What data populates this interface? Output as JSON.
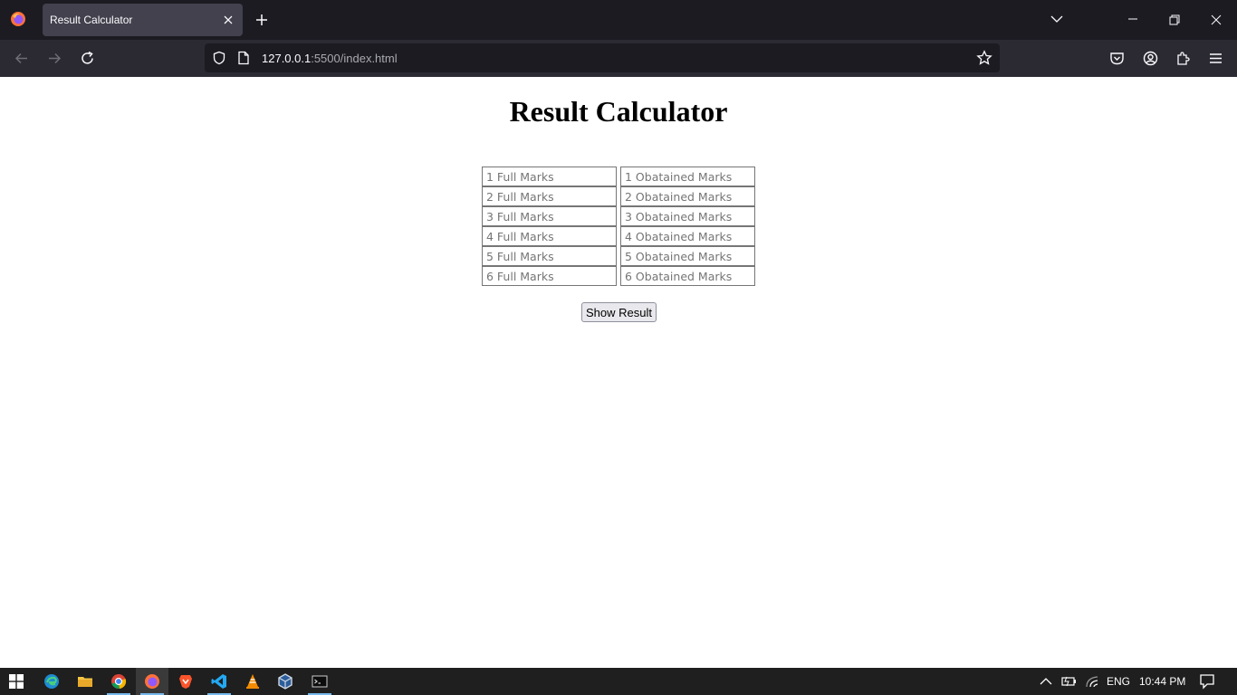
{
  "browser": {
    "tab_title": "Result Calculator",
    "url_host": "127.0.0.1",
    "url_rest": ":5500/index.html"
  },
  "page": {
    "title": "Result Calculator",
    "rows": [
      {
        "full_placeholder": "1 Full Marks",
        "obtained_placeholder": "1 Obatained Marks"
      },
      {
        "full_placeholder": "2 Full Marks",
        "obtained_placeholder": "2 Obatained Marks"
      },
      {
        "full_placeholder": "3 Full Marks",
        "obtained_placeholder": "3 Obatained Marks"
      },
      {
        "full_placeholder": "4 Full Marks",
        "obtained_placeholder": "4 Obatained Marks"
      },
      {
        "full_placeholder": "5 Full Marks",
        "obtained_placeholder": "5 Obatained Marks"
      },
      {
        "full_placeholder": "6 Full Marks",
        "obtained_placeholder": "6 Obatained Marks"
      }
    ],
    "button_label": "Show Result"
  },
  "taskbar": {
    "language": "ENG",
    "time": "10:44 PM"
  }
}
